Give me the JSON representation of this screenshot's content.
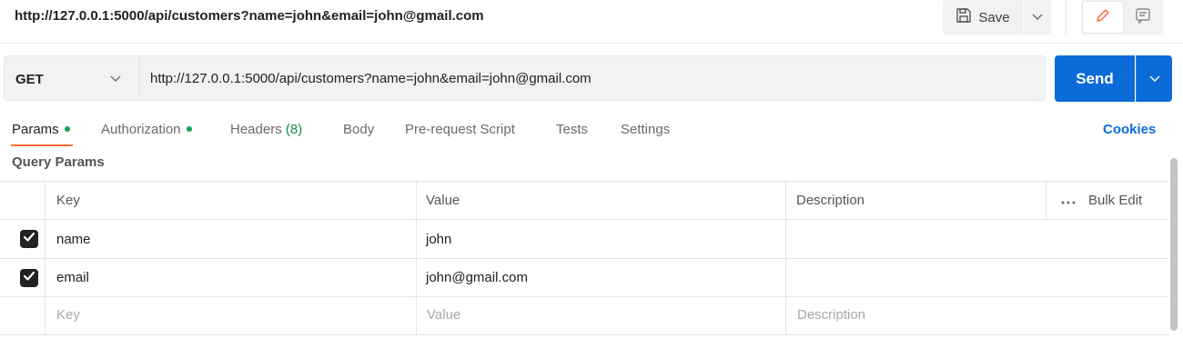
{
  "title_bar": {
    "request_title": "http://127.0.0.1:5000/api/customers?name=john&email=john@gmail.com",
    "save_label": "Save"
  },
  "url_bar": {
    "method": "GET",
    "url": "http://127.0.0.1:5000/api/customers?name=john&email=john@gmail.com",
    "send_label": "Send"
  },
  "tabs": {
    "params": "Params",
    "authorization": "Authorization",
    "headers": "Headers",
    "headers_count": "(8)",
    "body": "Body",
    "pre_request": "Pre-request Script",
    "tests": "Tests",
    "settings": "Settings",
    "cookies": "Cookies"
  },
  "query_params": {
    "section_label": "Query Params",
    "columns": {
      "key": "Key",
      "value": "Value",
      "description": "Description"
    },
    "bulk_edit": "Bulk Edit",
    "rows": [
      {
        "key": "name",
        "value": "john",
        "description": "",
        "enabled": true
      },
      {
        "key": "email",
        "value": "john@gmail.com",
        "description": "",
        "enabled": true
      }
    ],
    "placeholders": {
      "key": "Key",
      "value": "Value",
      "description": "Description"
    }
  },
  "colors": {
    "accent_blue": "#0b6bd9",
    "active_tab_orange": "#ff6c37",
    "status_green": "#0fa35c"
  },
  "icons": {
    "save": "save-icon",
    "edit": "pencil-icon",
    "comment": "comment-icon"
  }
}
